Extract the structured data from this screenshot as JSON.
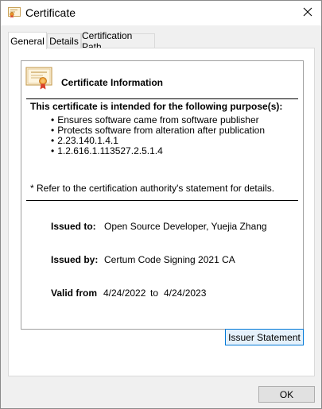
{
  "window": {
    "title": "Certificate"
  },
  "tabs": [
    {
      "label": "General",
      "active": true
    },
    {
      "label": "Details",
      "active": false
    },
    {
      "label": "Certification Path",
      "active": false
    }
  ],
  "info": {
    "title": "Certificate Information",
    "purpose_heading": "This certificate is intended for the following purpose(s):",
    "purposes": [
      "Ensures software came from software publisher",
      "Protects software from alteration after publication",
      "2.23.140.1.4.1",
      "1.2.616.1.113527.2.5.1.4"
    ],
    "note": "* Refer to the certification authority's statement for details.",
    "issued_to_label": "Issued to:",
    "issued_to_value": "Open Source Developer, Yuejia Zhang",
    "issued_by_label": "Issued by:",
    "issued_by_value": "Certum Code Signing 2021 CA",
    "valid_from_label": "Valid from",
    "valid_from_value": "4/24/2022",
    "valid_to_word": "to",
    "valid_to_value": "4/24/2023"
  },
  "buttons": {
    "issuer_statement": "Issuer Statement",
    "ok": "OK"
  },
  "icons": {
    "title": "certificate-icon",
    "close": "close-icon",
    "info": "certificate-icon"
  },
  "colors": {
    "accent": "#0078d7",
    "button_hover": "#e5f1fb",
    "window_bg": "#f0f0f0"
  }
}
